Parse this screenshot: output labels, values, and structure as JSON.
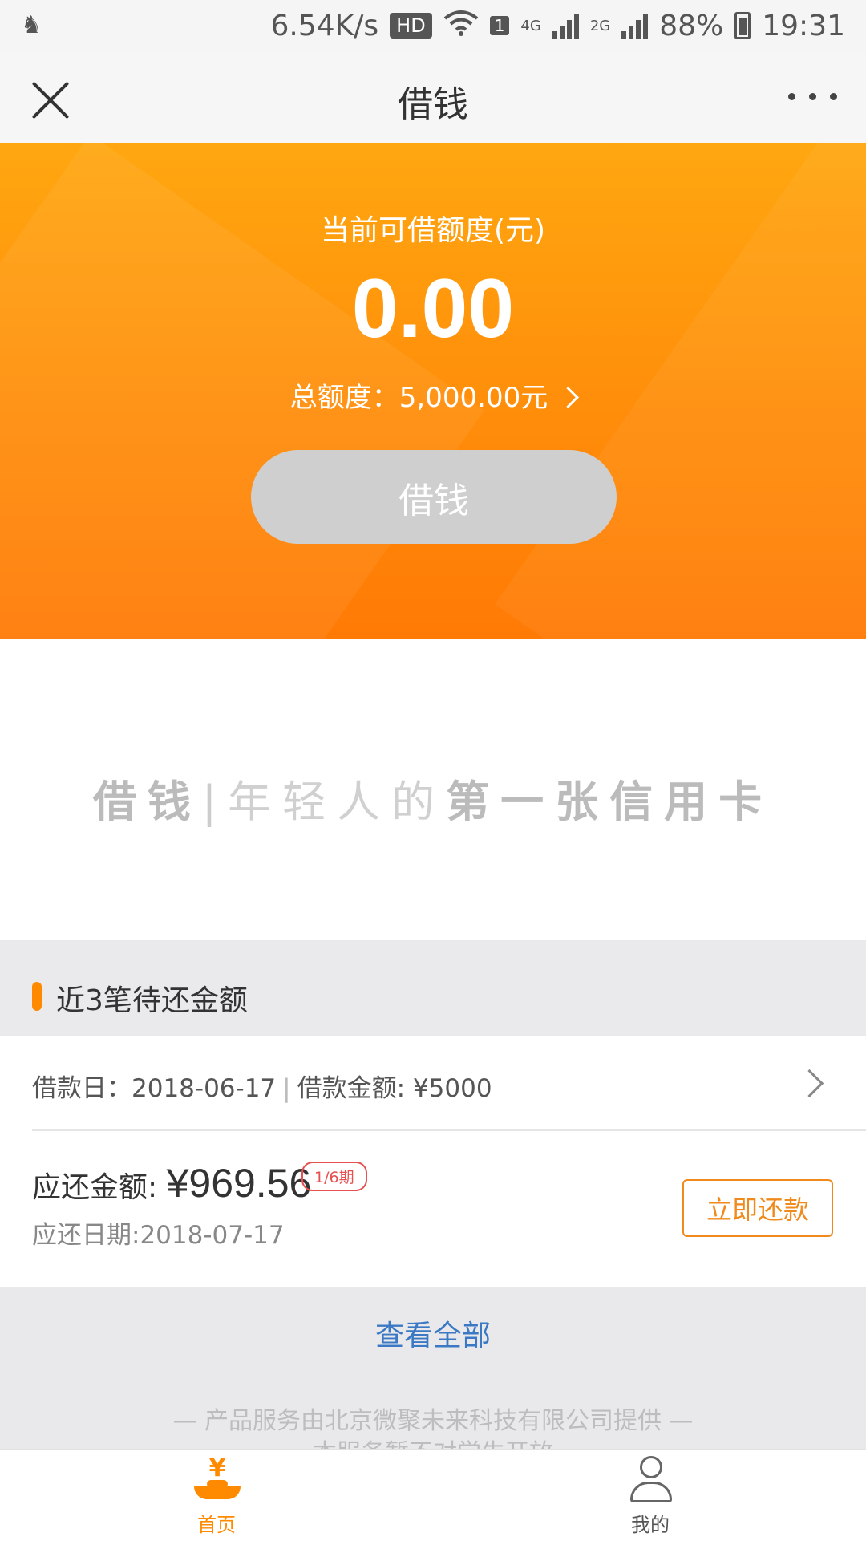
{
  "status_bar": {
    "speed": "6.54K/s",
    "hd": "HD",
    "sim": "1",
    "net_4g": "4G",
    "net_2g": "2G",
    "battery": "88%",
    "time": "19:31"
  },
  "nav": {
    "title": "借钱",
    "close_icon": "close-icon",
    "more_icon": "more-icon"
  },
  "hero": {
    "available_label": "当前可借额度(元)",
    "available_amount": "0.00",
    "total_label": "总额度：5,000.00元",
    "borrow_button": "借钱"
  },
  "slogan": {
    "brand": "借钱",
    "sep": "|",
    "light": "年轻人的",
    "bold": "第一张信用卡"
  },
  "pending": {
    "title": "近3笔待还金额",
    "loan_date": "借款日：2018-06-17",
    "divider": "|",
    "loan_amount": "借款金额: ¥5000",
    "repay_label": "应还金额: ",
    "repay_amount": "¥969.56",
    "period": "1/6期",
    "due_date": "应还日期:2018-07-17",
    "repay_button": "立即还款",
    "view_all": "查看全部"
  },
  "footer": {
    "provider": "— 产品服务由北京微聚未来科技有限公司提供 —",
    "notice": "本服务暂不对学生开放"
  },
  "tabs": [
    {
      "label": "首页",
      "icon": "home-yen-icon",
      "active": true
    },
    {
      "label": "我的",
      "icon": "user-icon",
      "active": false
    }
  ],
  "colors": {
    "accent": "#ff8a00",
    "link": "#3b79c4",
    "badge": "#e55050"
  }
}
